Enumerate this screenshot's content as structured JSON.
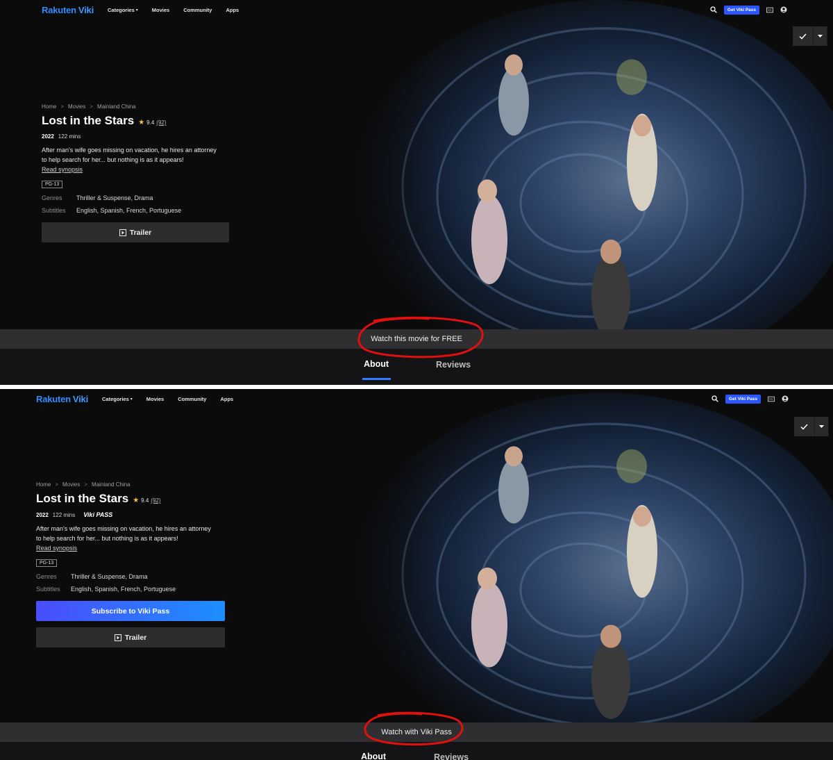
{
  "shots": [
    {
      "nav": {
        "brand_a": "Rakuten",
        "brand_b": "Viki",
        "links": [
          "Categories",
          "Movies",
          "Community",
          "Apps"
        ],
        "pass_button": "Get Viki Pass"
      },
      "breadcrumbs": [
        "Home",
        "Movies",
        "Mainland China"
      ],
      "title": "Lost in the Stars",
      "rating": "9.4",
      "rating_count": "(92)",
      "year": "2022",
      "duration": "122 mins",
      "blurb_line1": "After man's wife goes missing on vacation, he hires an attorney",
      "blurb_line2": "to help search for her... but nothing is as it appears!",
      "read_synopsis": "Read synopsis",
      "content_rating": "PG-13",
      "genres_label": "Genres",
      "genres": "Thriller & Suspense, Drama",
      "subtitles_label": "Subtitles",
      "subtitles": "English, Spanish, French, Portuguese",
      "trailer_button": "Trailer",
      "banner": "Watch this movie for FREE",
      "tabs": [
        "About",
        "Reviews"
      ]
    },
    {
      "nav": {
        "brand_a": "Rakuten",
        "brand_b": "Viki",
        "links": [
          "Categories",
          "Movies",
          "Community",
          "Apps"
        ],
        "pass_button": "Get Viki Pass"
      },
      "breadcrumbs": [
        "Home",
        "Movies",
        "Mainland China"
      ],
      "title": "Lost in the Stars",
      "rating": "9.4",
      "rating_count": "(92)",
      "year": "2022",
      "duration": "122 mins",
      "viki_pass_badge": "Viki PASS",
      "blurb_line1": "After man's wife goes missing on vacation, he hires an attorney",
      "blurb_line2": "to help search for her... but nothing is as it appears!",
      "read_synopsis": "Read synopsis",
      "content_rating": "PG-13",
      "genres_label": "Genres",
      "genres": "Thriller & Suspense, Drama",
      "subtitles_label": "Subtitles",
      "subtitles": "English, Spanish, French, Portuguese",
      "subscribe_button": "Subscribe to Viki Pass",
      "trailer_button": "Trailer",
      "banner": "Watch with Viki Pass",
      "tabs": [
        "About",
        "Reviews"
      ]
    }
  ],
  "colors": {
    "brand": "#2f8cff",
    "pass_button": "#2b55ff",
    "annotation": "#e01010",
    "tab_underline": "#2e7dff",
    "star": "#f6c545"
  }
}
